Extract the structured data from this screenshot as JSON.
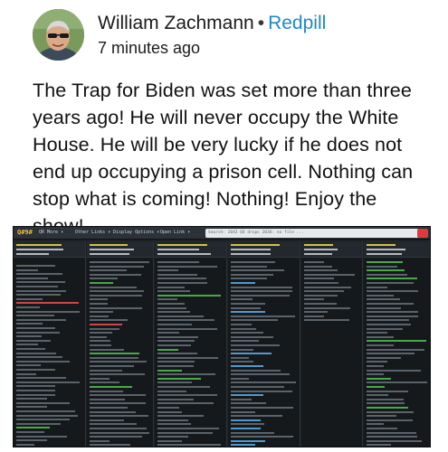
{
  "post": {
    "author": "William Zachmann",
    "separator": "•",
    "group": "Redpill",
    "timestamp": "7 minutes ago",
    "body": "The Trap for Biden was set more than three years ago! He will never occupy the White House. He will be very lucky if he does not end up occupying a prison cell. Nothing can stop what is coming! Nothing! Enjoy the show!"
  },
  "colors": {
    "group_link": "#1e88c8",
    "screenshot_bg": "#1d2125",
    "highlight_green": "#4fb84f",
    "highlight_blue": "#5aa7e0"
  },
  "screenshot": {
    "logo": "Q#9#",
    "menu": [
      "QR More ▾",
      "Other Links ▾",
      "Display Options ▾",
      "Open Link ▾"
    ],
    "search_text": "Search: 2043 Q4 drops 2036: no file ...",
    "icons": [
      "search-icon"
    ]
  }
}
